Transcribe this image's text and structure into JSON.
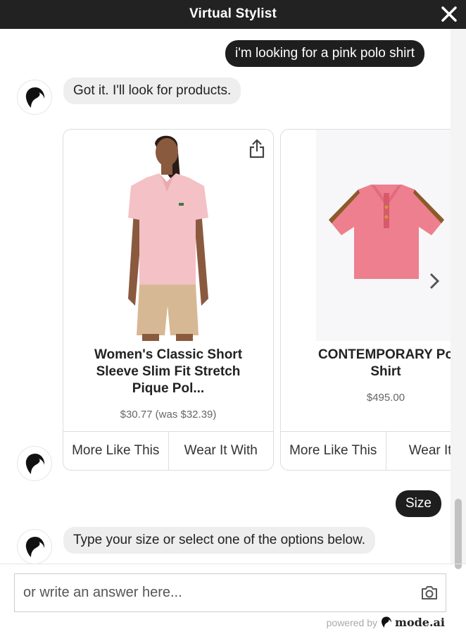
{
  "header": {
    "title": "Virtual Stylist"
  },
  "messages": {
    "user_query": "i'm looking for a pink polo shirt",
    "bot_reply": "Got it. I'll look for products.",
    "size_chip": "Size",
    "bot_size_prompt": "Type your size or select one of the options below."
  },
  "products": [
    {
      "title_line1": "Women's Classic Short",
      "title_line2": "Sleeve Slim Fit Stretch",
      "title_line3": "Pique Pol...",
      "price": "$30.77 (was $32.39)",
      "more_like_this": "More Like This",
      "wear_it_with": "Wear It With"
    },
    {
      "title_line1": "CONTEMPORARY Po",
      "title_line2": "Shirt",
      "price": "$495.00",
      "more_like_this": "More Like This",
      "wear_it_with": "Wear It W"
    }
  ],
  "input": {
    "placeholder": "or write an answer here..."
  },
  "footer": {
    "powered_by": "powered by",
    "brand": "mode.ai"
  },
  "colors": {
    "header_bg": "#222222",
    "user_bubble": "#1e1e1e",
    "bot_bubble": "#eeeeee"
  },
  "icons": [
    "close-icon",
    "avatar-icon",
    "share-icon",
    "chevron-right-icon",
    "camera-icon",
    "mode-logo-icon"
  ]
}
